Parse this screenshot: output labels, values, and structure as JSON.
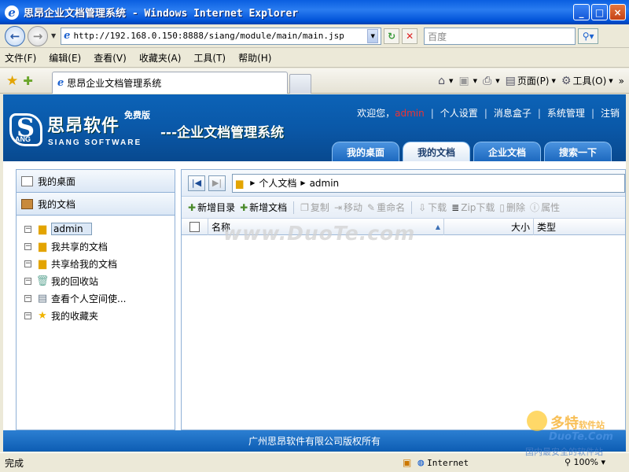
{
  "window": {
    "title": "思昂企业文档管理系统 - Windows Internet Explorer",
    "minimize": "_",
    "maximize": "□",
    "close": "×"
  },
  "address": {
    "url": "http://192.168.0.150:8888/siang/module/main/main.jsp",
    "search_placeholder": "百度"
  },
  "menu": [
    "文件(F)",
    "编辑(E)",
    "查看(V)",
    "收藏夹(A)",
    "工具(T)",
    "帮助(H)"
  ],
  "browser_tab": {
    "title": "思昂企业文档管理系统"
  },
  "commands": {
    "page": "页面(P)",
    "tools": "工具(O)"
  },
  "header": {
    "brand_cn": "思昂软件",
    "free_edition": "免费版",
    "brand_en": "SIANG SOFTWARE",
    "system_title": "---企业文档管理系统",
    "logo_letters": "ANG",
    "welcome": "欢迎您，",
    "username": "admin",
    "links": [
      "个人设置",
      "消息盒子",
      "系统管理",
      "注销"
    ],
    "tabs": [
      {
        "label": "我的桌面",
        "active": false
      },
      {
        "label": "我的文档",
        "active": true
      },
      {
        "label": "企业文档",
        "active": false
      },
      {
        "label": "搜索一下",
        "active": false
      }
    ]
  },
  "sidebar": {
    "headers": [
      "我的桌面",
      "我的文档"
    ],
    "tree": [
      "admin",
      "我共享的文档",
      "共享给我的文档",
      "我的回收站",
      "查看个人空间使...",
      "我的收藏夹"
    ]
  },
  "main": {
    "path": [
      "个人文档",
      "admin"
    ],
    "toolbar": {
      "new_folder": "新增目录",
      "new_doc": "新增文档",
      "copy": "复制",
      "move": "移动",
      "rename": "重命名",
      "download": "下载",
      "zip": "Zip下载",
      "delete": "删除",
      "props": "属性"
    },
    "columns": {
      "name": "名称",
      "size": "大小",
      "type": "类型"
    }
  },
  "watermark": "www.DuoTe.com",
  "footer": "广州思昂软件有限公司版权所有",
  "status": {
    "text": "完成",
    "zone": "Internet",
    "zoom": "100%"
  },
  "brand_watermark": {
    "cn": "多特",
    "cn_small": "软件站",
    "en": "DuoTe.Com",
    "sub": "国内最安全的软件站"
  }
}
